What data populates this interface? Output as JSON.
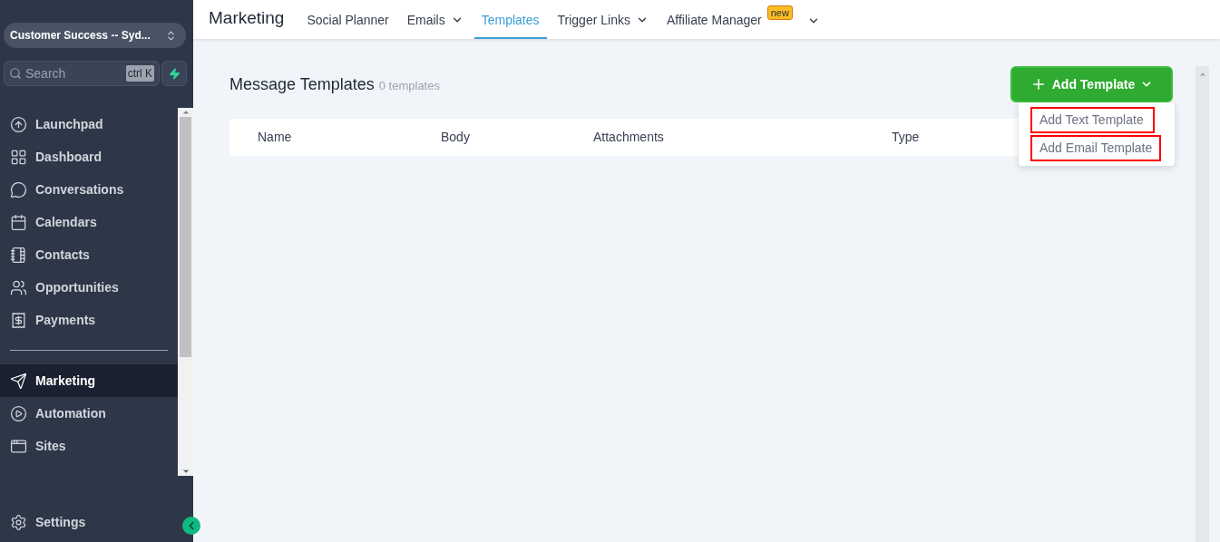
{
  "sidebar": {
    "location": "Customer Success -- Syd...",
    "search": {
      "placeholder": "Search",
      "shortcut": "ctrl K"
    },
    "items": [
      {
        "label": "Launchpad",
        "selected": false,
        "group_start": false
      },
      {
        "label": "Dashboard",
        "selected": false,
        "group_start": false
      },
      {
        "label": "Conversations",
        "selected": false,
        "group_start": false
      },
      {
        "label": "Calendars",
        "selected": false,
        "group_start": false
      },
      {
        "label": "Contacts",
        "selected": false,
        "group_start": false
      },
      {
        "label": "Opportunities",
        "selected": false,
        "group_start": false
      },
      {
        "label": "Payments",
        "selected": false,
        "group_start": false
      },
      {
        "label": "Marketing",
        "selected": true,
        "group_start": true
      },
      {
        "label": "Automation",
        "selected": false,
        "group_start": false
      },
      {
        "label": "Sites",
        "selected": false,
        "group_start": false
      }
    ],
    "settings": "Settings"
  },
  "topbar": {
    "title": "Marketing",
    "tabs": [
      {
        "label": "Social Planner",
        "selected": false,
        "dropdown": false
      },
      {
        "label": "Emails",
        "selected": false,
        "dropdown": true
      },
      {
        "label": "Templates",
        "selected": true,
        "dropdown": false
      },
      {
        "label": "Trigger Links",
        "selected": false,
        "dropdown": true
      },
      {
        "label": "Affiliate Manager",
        "selected": false,
        "dropdown": false,
        "badge": "new"
      }
    ]
  },
  "content": {
    "title": "Message Templates",
    "count": "0 templates",
    "add_button": "Add Template",
    "menu": [
      {
        "label": "Add Text Template",
        "highlighted": true
      },
      {
        "label": "Add Email Template",
        "highlighted": true
      }
    ],
    "table": {
      "columns": [
        "Name",
        "Body",
        "Attachments",
        "Type"
      ]
    }
  }
}
